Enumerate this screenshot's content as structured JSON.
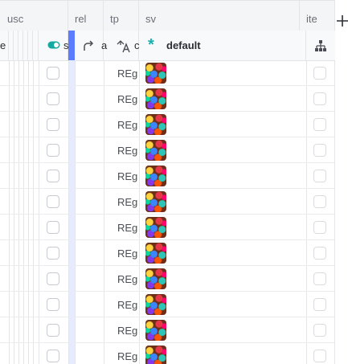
{
  "groups": {
    "usc": "usc",
    "rel": "rel",
    "tp": "tp",
    "sv": "sv",
    "ite": "ite"
  },
  "headers": {
    "partial_left": "e",
    "toggle_col_partial": "s",
    "rel_col_partial": "a",
    "tp_col_partial": "c",
    "sv_default": "default"
  },
  "icons": {
    "toggle": "toggle-icon",
    "rel": "redo-arrow-icon",
    "tp": "text-style-icon",
    "sv": "asterisk-icon",
    "ite": "hierarchy-icon",
    "add": "plus-icon"
  },
  "colors": {
    "accent": "#5b7cff",
    "asterisk": "#1ab0b0",
    "toggle": "#16a9a0"
  },
  "rows": [
    {
      "tp": "REgM"
    },
    {
      "tp": "REgM"
    },
    {
      "tp": "REgM"
    },
    {
      "tp": "REgM"
    },
    {
      "tp": "REgM"
    },
    {
      "tp": "REgM"
    },
    {
      "tp": "REgM"
    },
    {
      "tp": "REgM"
    },
    {
      "tp": "REgM"
    },
    {
      "tp": "REgM"
    },
    {
      "tp": "REgM"
    },
    {
      "tp": "REgM"
    }
  ]
}
